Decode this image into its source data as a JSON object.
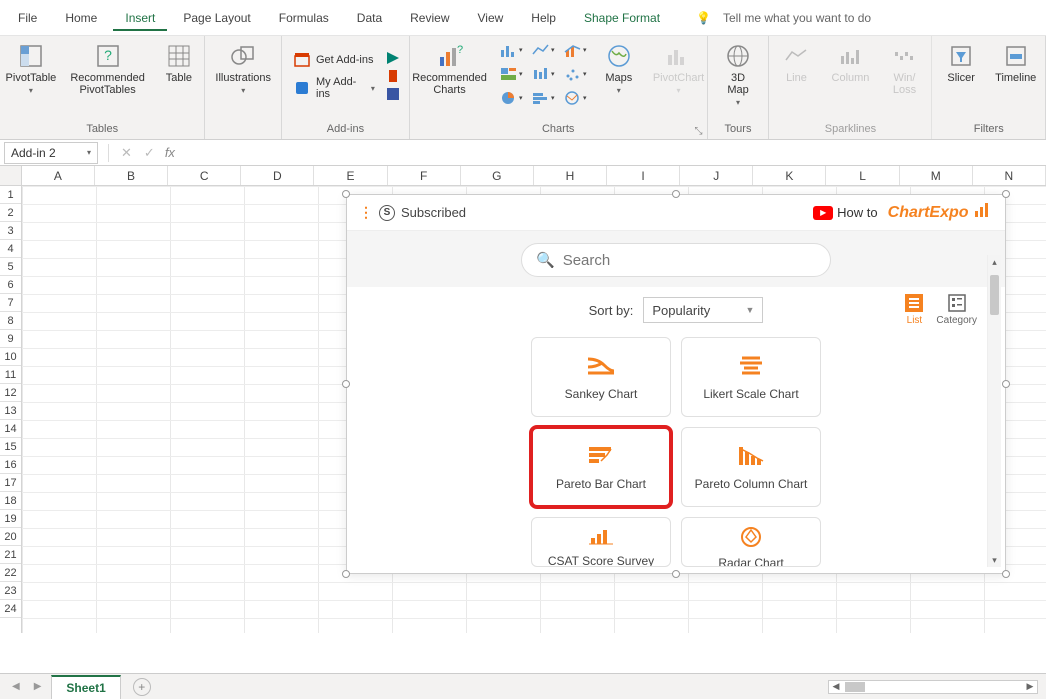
{
  "menu": {
    "items": [
      "File",
      "Home",
      "Insert",
      "Page Layout",
      "Formulas",
      "Data",
      "Review",
      "View",
      "Help",
      "Shape Format"
    ],
    "active": "Insert",
    "contextual": "Shape Format",
    "tellme": "Tell me what you want to do"
  },
  "ribbon": {
    "groups": {
      "tables": {
        "label": "Tables",
        "pivottable": "PivotTable",
        "recommended_pt": "Recommended\nPivotTables",
        "table": "Table"
      },
      "illustrations": {
        "label": "",
        "btn": "Illustrations"
      },
      "addins": {
        "label": "Add-ins",
        "get": "Get Add-ins",
        "my": "My Add-ins"
      },
      "charts": {
        "label": "Charts",
        "recommended": "Recommended\nCharts",
        "maps": "Maps",
        "pivotchart": "PivotChart"
      },
      "tours": {
        "label": "Tours",
        "map3d": "3D\nMap"
      },
      "sparklines": {
        "label": "Sparklines",
        "line": "Line",
        "column": "Column",
        "winloss": "Win/\nLoss"
      },
      "filters": {
        "label": "Filters",
        "slicer": "Slicer",
        "timeline": "Timeline"
      }
    }
  },
  "formula_bar": {
    "namebox": "Add-in 2"
  },
  "grid": {
    "columns": [
      "A",
      "B",
      "C",
      "D",
      "E",
      "F",
      "G",
      "H",
      "I",
      "J",
      "K",
      "L",
      "M",
      "N"
    ],
    "rows_visible": 24
  },
  "addin": {
    "subscribed": "Subscribed",
    "howto": "How to",
    "brand": "ChartExpo",
    "search_placeholder": "Search",
    "sort_label": "Sort by:",
    "sort_value": "Popularity",
    "view_list": "List",
    "view_category": "Category",
    "charts": [
      {
        "name": "Sankey Chart",
        "icon": "sankey"
      },
      {
        "name": "Likert Scale Chart",
        "icon": "likert"
      },
      {
        "name": "Pareto Bar Chart",
        "icon": "paretobar",
        "highlight": true
      },
      {
        "name": "Pareto Column Chart",
        "icon": "paretocol"
      },
      {
        "name": "CSAT Score Survey",
        "icon": "csat",
        "cut": true
      },
      {
        "name": "Radar Chart",
        "icon": "radar",
        "cut": true
      }
    ]
  },
  "sheets": {
    "active": "Sheet1"
  }
}
